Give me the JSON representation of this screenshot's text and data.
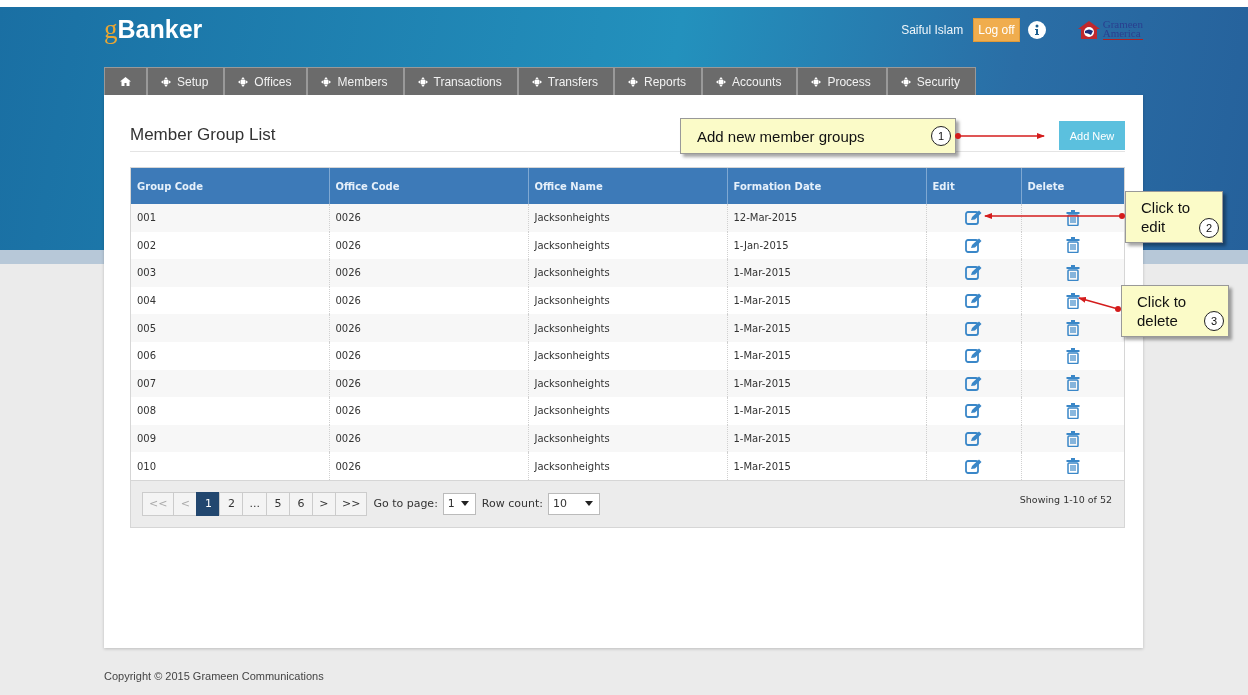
{
  "header": {
    "logo": {
      "prefix": "g",
      "name": "Banker"
    },
    "user": "Saiful Islam",
    "logoff": "Log off",
    "partner_logo": [
      "Grameen",
      "America"
    ]
  },
  "nav": [
    {
      "kind": "home"
    },
    {
      "kind": "menu",
      "label": "Setup"
    },
    {
      "kind": "menu",
      "label": "Offices"
    },
    {
      "kind": "menu",
      "label": "Members"
    },
    {
      "kind": "menu",
      "label": "Transactions"
    },
    {
      "kind": "menu",
      "label": "Transfers"
    },
    {
      "kind": "menu",
      "label": "Reports"
    },
    {
      "kind": "menu",
      "label": "Accounts"
    },
    {
      "kind": "menu",
      "label": "Process"
    },
    {
      "kind": "menu",
      "label": "Security"
    }
  ],
  "page": {
    "title": "Member Group List",
    "add_button": "Add New"
  },
  "table": {
    "columns": [
      "Group Code",
      "Office Code",
      "Office Name",
      "Formation Date",
      "Edit",
      "Delete"
    ],
    "rows": [
      {
        "group_code": "001",
        "office_code": "0026",
        "office_name": "Jacksonheights",
        "formation_date": "12-Mar-2015"
      },
      {
        "group_code": "002",
        "office_code": "0026",
        "office_name": "Jacksonheights",
        "formation_date": "1-Jan-2015"
      },
      {
        "group_code": "003",
        "office_code": "0026",
        "office_name": "Jacksonheights",
        "formation_date": "1-Mar-2015"
      },
      {
        "group_code": "004",
        "office_code": "0026",
        "office_name": "Jacksonheights",
        "formation_date": "1-Mar-2015"
      },
      {
        "group_code": "005",
        "office_code": "0026",
        "office_name": "Jacksonheights",
        "formation_date": "1-Mar-2015"
      },
      {
        "group_code": "006",
        "office_code": "0026",
        "office_name": "Jacksonheights",
        "formation_date": "1-Mar-2015"
      },
      {
        "group_code": "007",
        "office_code": "0026",
        "office_name": "Jacksonheights",
        "formation_date": "1-Mar-2015"
      },
      {
        "group_code": "008",
        "office_code": "0026",
        "office_name": "Jacksonheights",
        "formation_date": "1-Mar-2015"
      },
      {
        "group_code": "009",
        "office_code": "0026",
        "office_name": "Jacksonheights",
        "formation_date": "1-Mar-2015"
      },
      {
        "group_code": "010",
        "office_code": "0026",
        "office_name": "Jacksonheights",
        "formation_date": "1-Mar-2015"
      }
    ]
  },
  "pager": {
    "buttons": [
      {
        "label": "<<",
        "disabled": true,
        "selected": false
      },
      {
        "label": "<",
        "disabled": true,
        "selected": false
      },
      {
        "label": "1",
        "disabled": false,
        "selected": true
      },
      {
        "label": "2",
        "disabled": false,
        "selected": false
      },
      {
        "label": "...",
        "disabled": false,
        "selected": false
      },
      {
        "label": "5",
        "disabled": false,
        "selected": false
      },
      {
        "label": "6",
        "disabled": false,
        "selected": false
      },
      {
        "label": ">",
        "disabled": false,
        "selected": false
      },
      {
        "label": ">>",
        "disabled": false,
        "selected": false
      }
    ],
    "goto_label": "Go to page:",
    "goto_value": "1",
    "rowcount_label": "Row count:",
    "rowcount_value": "10",
    "summary": "Showing 1-10 of 52"
  },
  "callouts": [
    {
      "text": "Add new member groups",
      "number": "1"
    },
    {
      "text": "Click to edit",
      "number": "2"
    },
    {
      "text": "Click to delete",
      "number": "3"
    }
  ],
  "footer": "Copyright © 2015 Grameen Communications"
}
